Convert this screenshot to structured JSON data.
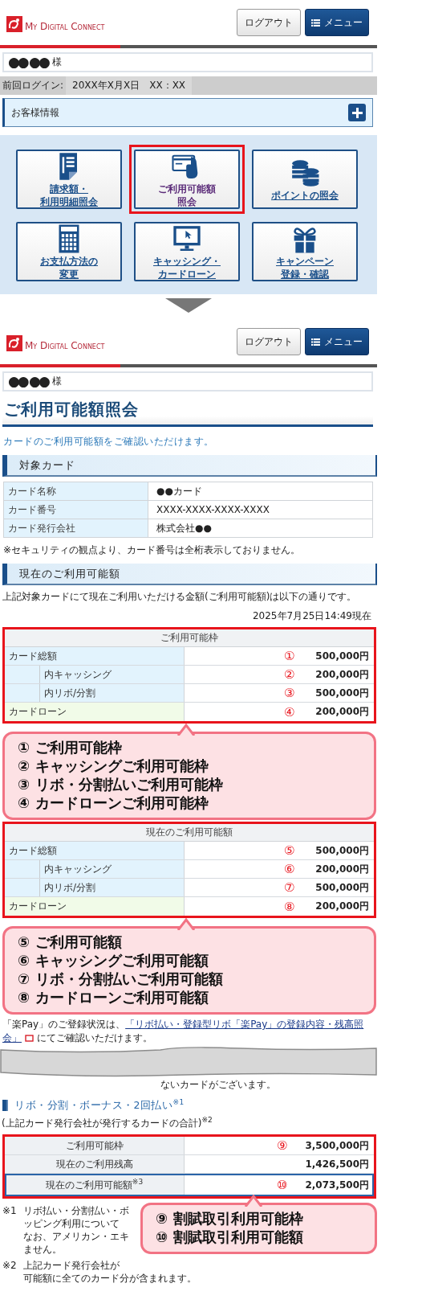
{
  "top_screen": {
    "header": {
      "logo_text": "My Digital Connect",
      "logout_button": "ログアウト",
      "menu_button": "メニュー"
    },
    "customer_name": "●● ●●",
    "honorific": "様",
    "last_login": {
      "label": "前回ログイン:",
      "value": "20XX年X月X日　XX：XX"
    },
    "customer_info": {
      "label": "お客様情報",
      "expanded": false
    },
    "tiles": [
      {
        "kind": "statement",
        "lines": [
          "請求額・",
          "利用明細照会"
        ],
        "highlighted": false
      },
      {
        "kind": "card",
        "lines": [
          "ご利用可能額",
          "照会"
        ],
        "highlighted": true
      },
      {
        "kind": "coins",
        "lines": [
          "ポイントの照会"
        ],
        "highlighted": false
      },
      {
        "kind": "calculator",
        "lines": [
          "お支払方法の",
          "変更"
        ],
        "highlighted": false
      },
      {
        "kind": "monitor",
        "lines": [
          "キャッシング・",
          "カードローン"
        ],
        "highlighted": false
      },
      {
        "kind": "gift",
        "lines": [
          "キャンペーン",
          "登録・確認"
        ],
        "highlighted": false
      }
    ]
  },
  "result_screen": {
    "header": {
      "logo_text": "My Digital Connect",
      "logout_button": "ログアウト",
      "menu_button": "メニュー"
    },
    "customer_name": "●● ●●",
    "honorific": "様",
    "title": "ご利用可能額照会",
    "description": "カードのご利用可能額をご確認いただけます。",
    "card_section": {
      "heading": "対象カード",
      "rows": [
        {
          "label": "カード名称",
          "value": "●●カード"
        },
        {
          "label": "カード番号",
          "value": "XXXX-XXXX-XXXX-XXXX"
        },
        {
          "label": "カード発行会社",
          "value": "株式会社●●"
        }
      ],
      "note": "※セキュリティの観点より、カード番号は全桁表示しておりません。"
    },
    "limit_section": {
      "heading": "現在のご利用可能額",
      "intro": "上記対象カードにて現在ご利用いただける金額(ご利用可能額)は以下の通りです。",
      "as_of": "2025年7月25日14:49現在",
      "tables": [
        {
          "title": "ご利用可能枠",
          "rows": [
            {
              "kind": "total",
              "label": "カード総額",
              "marker": "①",
              "amount": "500,000円"
            },
            {
              "kind": "sub",
              "label": "内キャッシング",
              "marker": "②",
              "amount": "200,000円"
            },
            {
              "kind": "sub",
              "label": "内リボ/分割",
              "marker": "③",
              "amount": "500,000円"
            },
            {
              "kind": "loan",
              "label": "カードローン",
              "marker": "④",
              "amount": "200,000円"
            }
          ],
          "callout": [
            "① ご利用可能枠",
            "② キャッシングご利用可能枠",
            "③ リボ・分割払いご利用可能枠",
            "④ カードローンご利用可能枠"
          ]
        },
        {
          "title": "現在のご利用可能額",
          "rows": [
            {
              "kind": "total",
              "label": "カード総額",
              "marker": "⑤",
              "amount": "500,000円"
            },
            {
              "kind": "sub",
              "label": "内キャッシング",
              "marker": "⑥",
              "amount": "200,000円"
            },
            {
              "kind": "sub",
              "label": "内リボ/分割",
              "marker": "⑦",
              "amount": "500,000円"
            },
            {
              "kind": "loan",
              "label": "カードローン",
              "marker": "⑧",
              "amount": "200,000円"
            }
          ],
          "callout": [
            "⑤ ご利用可能額",
            "⑥ キャッシングご利用可能額",
            "⑦ リボ・分割払いご利用可能額",
            "⑧ カードローンご利用可能額"
          ]
        }
      ]
    },
    "notes": {
      "text_1": "「楽Pay」のご登録状況は、",
      "link_1": "「リボ払い・登録型リボ「楽Pay」の登録内容・残高照",
      "link_2": "会」",
      "text_2": "にてご確認いただけます。",
      "text_3": "ないカードがございます。"
    },
    "installment_section": {
      "heading": "リボ・分割・ボーナス・2回払い$^{※1}$",
      "subheading": "(上記カード発行会社が発行するカードの合計)$^{※2}$",
      "rows": [
        {
          "label": "ご利用可能枠",
          "marker": "⑨",
          "amount": "3,500,000円",
          "highlighted": false
        },
        {
          "label": "現在のご利用残高",
          "amount": "1,426,500円",
          "highlighted": false
        },
        {
          "label": "現在のご利用可能額$^{※3}$",
          "marker": "⑩",
          "amount": "2,073,500円",
          "highlighted": true
        }
      ],
      "callout": [
        "⑨ 割賦取引利用可能枠",
        "⑩ 割賦取引利用可能額"
      ]
    },
    "footnotes": [
      {
        "mark": "※1",
        "lines": [
          "リボ払い・分割払い・ボ",
          "ッピング利用について",
          "なお、アメリカン・エキ",
          "ません。"
        ]
      },
      {
        "mark": "※2",
        "lines": [
          "上記カード発行会社が",
          "可能額に全てのカード分が含まれます。"
        ]
      }
    ]
  }
}
